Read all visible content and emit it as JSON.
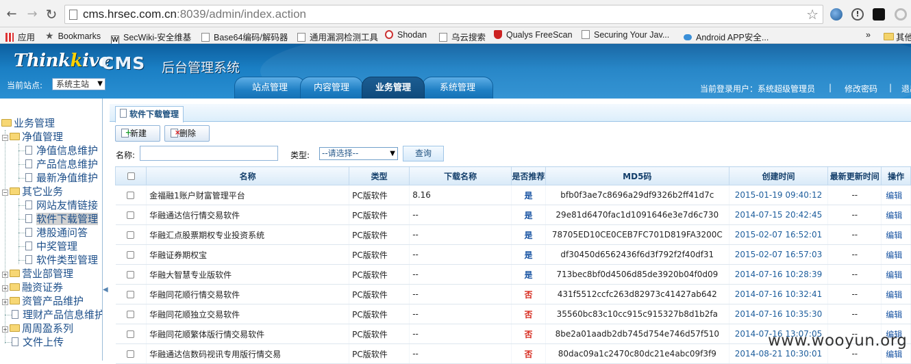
{
  "browser": {
    "url_host": "cms.hrsec.com.cn",
    "url_rest": ":8039/admin/index.action",
    "bookmarks": [
      {
        "label": "应用",
        "icon": "apps-icon"
      },
      {
        "label": "Bookmarks",
        "icon": "star-icon"
      },
      {
        "label": "SecWiki-安全维基",
        "icon": "w-icon"
      },
      {
        "label": "Base64编码/解码器",
        "icon": "page-icon"
      },
      {
        "label": "通用漏洞检测工具",
        "icon": "page-icon"
      },
      {
        "label": "Shodan",
        "icon": "shodan-icon"
      },
      {
        "label": "乌云搜索",
        "icon": "page-icon"
      },
      {
        "label": "Qualys FreeScan",
        "icon": "qualys-icon"
      },
      {
        "label": "Securing Your Jav...",
        "icon": "page-icon"
      },
      {
        "label": "Android APP安全...",
        "icon": "cloud-icon"
      },
      {
        "label": "»",
        "icon": ""
      },
      {
        "label": "其他",
        "icon": "folder-icon"
      }
    ]
  },
  "header": {
    "logo_think": "Think",
    "logo_kive": "ive",
    "logo_cms": "CMS",
    "logo_sub": "后台管理系统",
    "site_label": "当前站点:",
    "site_value": "系统主站",
    "tabs": [
      "站点管理",
      "内容管理",
      "业务管理",
      "系统管理"
    ],
    "user_text": "当前登录用户：系统超级管理员",
    "sep": "|",
    "change_pwd": "修改密码",
    "logout": "退出"
  },
  "sidebar": {
    "items": [
      {
        "label": "业务管理"
      },
      {
        "label": "净值管理"
      },
      {
        "label": "净值信息维护"
      },
      {
        "label": "产品信息维护"
      },
      {
        "label": "最新净值维护"
      },
      {
        "label": "其它业务"
      },
      {
        "label": "网站友情链接"
      },
      {
        "label": "软件下载管理"
      },
      {
        "label": "港股通问答"
      },
      {
        "label": "中奖管理"
      },
      {
        "label": "软件类型管理"
      },
      {
        "label": "营业部管理"
      },
      {
        "label": "融资证券"
      },
      {
        "label": "资管产品维护"
      },
      {
        "label": "理财产品信息维护"
      },
      {
        "label": "周周盈系列"
      },
      {
        "label": "文件上传"
      }
    ]
  },
  "main": {
    "panel_title": "软件下载管理",
    "btn_new": "新建",
    "btn_delete": "删除",
    "name_label": "名称:",
    "type_label": "类型:",
    "type_placeholder": "--请选择--",
    "query": "查询",
    "columns": [
      "名称",
      "类型",
      "下载名称",
      "是否推荐",
      "MD5码",
      "创建时间",
      "最新更新时间",
      "操作"
    ],
    "edit_label": "编辑",
    "rows": [
      {
        "name": "金福融1账户财富管理平台",
        "type": "PC版软件",
        "download": "8.16",
        "rec": "是",
        "md5": "bfb0f3ae7c8696a29df9326b2ff41d7c",
        "created": "2015-01-19 09:40:12",
        "updated": "--"
      },
      {
        "name": "华融通达信行情交易软件",
        "type": "PC版软件",
        "download": "--",
        "rec": "是",
        "md5": "29e81d6470fac1d1091646e3e7d6c730",
        "created": "2014-07-15 20:42:45",
        "updated": "--"
      },
      {
        "name": "华融汇点股票期权专业投资系统",
        "type": "PC版软件",
        "download": "--",
        "rec": "是",
        "md5": "78705ED10CE0CEB7FC701D819FA3200C",
        "created": "2015-02-07 16:52:01",
        "updated": "--"
      },
      {
        "name": "华融证券期权宝",
        "type": "PC版软件",
        "download": "--",
        "rec": "是",
        "md5": "df30450d6562436f6d3f792f2f40df31",
        "created": "2015-02-07 16:57:03",
        "updated": "--"
      },
      {
        "name": "华融大智慧专业版软件",
        "type": "PC版软件",
        "download": "--",
        "rec": "是",
        "md5": "713bec8bf0d4506d85de3920b04f0d09",
        "created": "2014-07-16 10:28:39",
        "updated": "--"
      },
      {
        "name": "华融同花顺行情交易软件",
        "type": "PC版软件",
        "download": "--",
        "rec": "否",
        "md5": "431f5512ccfc263d82973c41427ab642",
        "created": "2014-07-16 10:32:41",
        "updated": "--"
      },
      {
        "name": "华融同花顺独立交易软件",
        "type": "PC版软件",
        "download": "--",
        "rec": "否",
        "md5": "35560bc83c10cc915c915327b8d1b2fa",
        "created": "2014-07-16 10:35:30",
        "updated": "--"
      },
      {
        "name": "华融同花顺繁体版行情交易软件",
        "type": "PC版软件",
        "download": "--",
        "rec": "否",
        "md5": "8be2a01aadb2db745d754e746d57f510",
        "created": "2014-07-16 13:07:05",
        "updated": "--"
      },
      {
        "name": "华融通达信数码视讯专用版行情交易",
        "type": "PC版软件",
        "download": "--",
        "rec": "否",
        "md5": "80dac09a1c2470c80dc21e4abc09f3f9",
        "created": "2014-08-21 10:30:01",
        "updated": "--"
      }
    ]
  },
  "colors": {
    "rec_yes": "#1a55a3",
    "rec_no": "#d62a1e"
  },
  "watermark": "www.wooyun.org"
}
